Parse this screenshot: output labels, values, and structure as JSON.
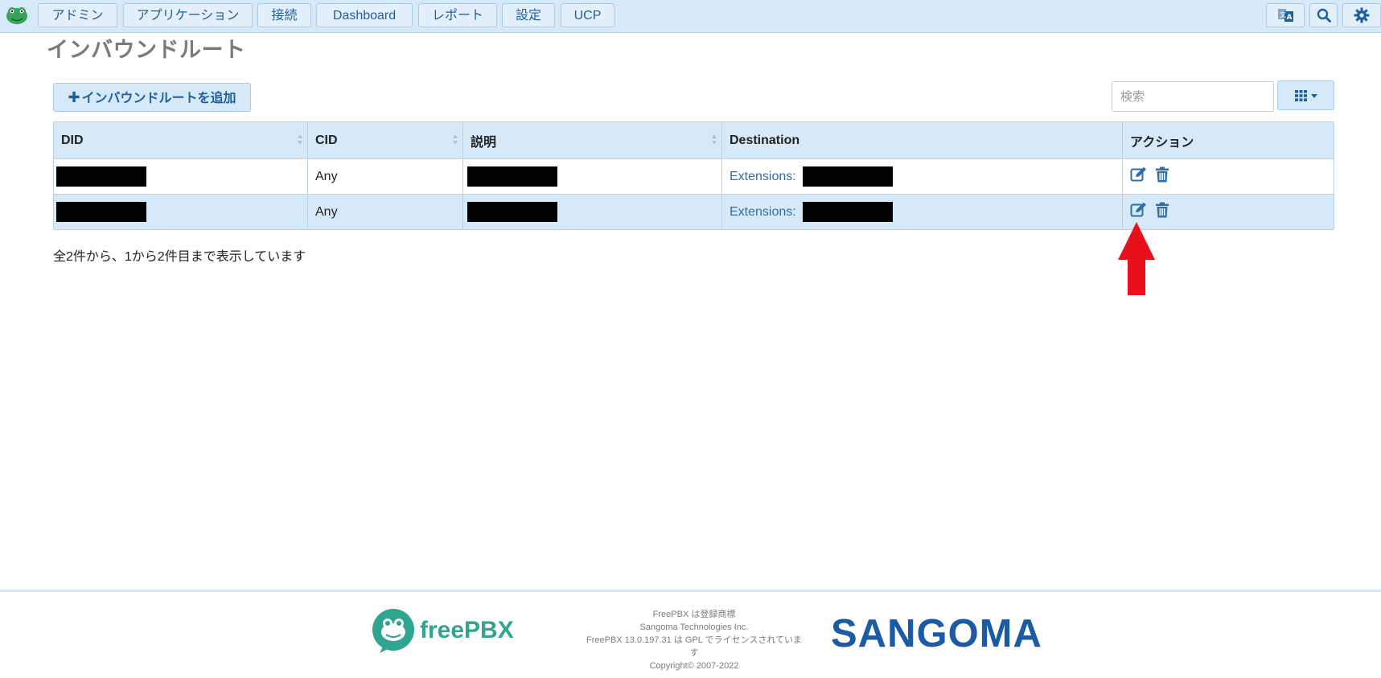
{
  "nav": {
    "items": [
      "アドミン",
      "アプリケーション",
      "接続",
      "Dashboard",
      "レポート",
      "設定",
      "UCP"
    ],
    "icons": [
      "translate-icon",
      "search-icon",
      "gear-icon"
    ]
  },
  "page": {
    "title": "インバウンドルート",
    "add_button_label": "インバウンドルートを追加",
    "search_placeholder": "検索"
  },
  "table": {
    "headers": [
      "DID",
      "CID",
      "説明",
      "Destination",
      "アクション"
    ],
    "rows": [
      {
        "did": "",
        "cid": "Any",
        "description": "",
        "destination_prefix": "Extensions:",
        "destination_value": ""
      },
      {
        "did": "",
        "cid": "Any",
        "description": "",
        "destination_prefix": "Extensions:",
        "destination_value": ""
      }
    ],
    "info": "全2件から、1から2件目まで表示しています"
  },
  "footer": {
    "logo_text": "freePBX",
    "lines": [
      "FreePBX は登録商標",
      "Sangoma Technologies Inc.",
      "FreePBX 13.0.197.31 は GPL でライセンスされていま",
      "す",
      "Copyright© 2007-2022"
    ],
    "sangoma_logo": "SANGOMA"
  },
  "colors": {
    "accent": "#1f5f9a",
    "header_bg": "#d6e9f8",
    "arrow": "#e8101a"
  }
}
